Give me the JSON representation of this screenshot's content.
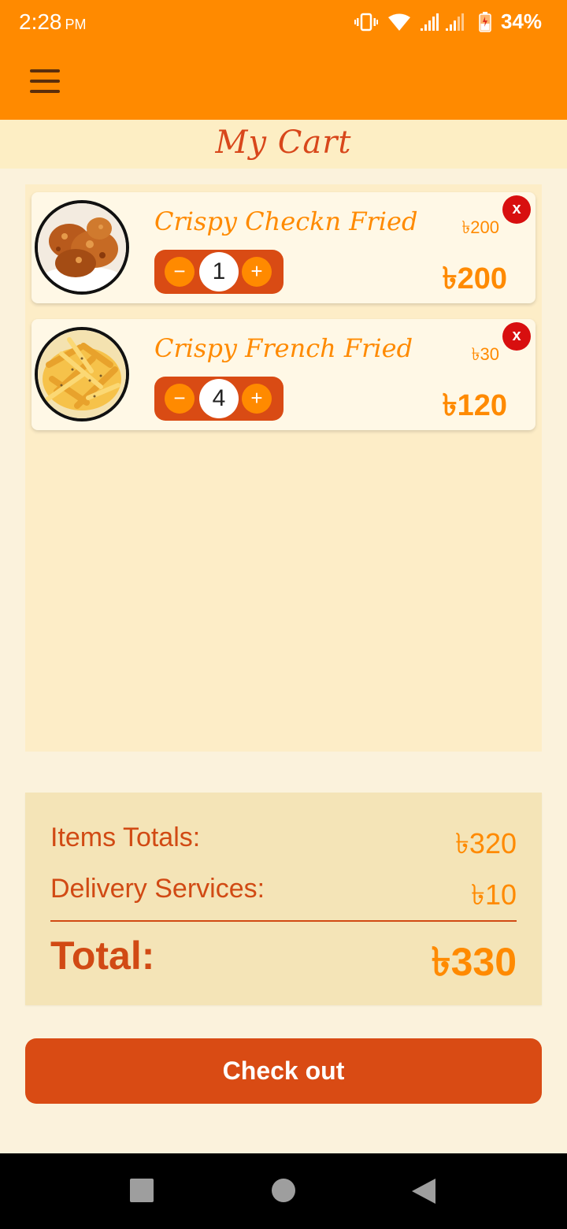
{
  "status_bar": {
    "time": "2:28",
    "ampm": "PM",
    "battery": "34%"
  },
  "page_title": "My Cart",
  "cart_items": [
    {
      "name": "Crispy Checkn Fried",
      "unit_price": "৳200",
      "quantity": "1",
      "line_total": "৳200",
      "remove_label": "x",
      "minus_label": "−",
      "plus_label": "+",
      "image": "fried-chicken-image"
    },
    {
      "name": "Crispy French Fried",
      "unit_price": "৳30",
      "quantity": "4",
      "line_total": "৳120",
      "remove_label": "x",
      "minus_label": "−",
      "plus_label": "+",
      "image": "french-fries-image"
    }
  ],
  "summary": {
    "items_label": "Items Totals:",
    "items_value": "৳320",
    "delivery_label": "Delivery Services:",
    "delivery_value": "৳10",
    "total_label": "Total:",
    "total_value": "৳330"
  },
  "checkout_label": "Check out",
  "colors": {
    "primary": "#ff8a00",
    "accent": "#d94b14",
    "remove": "#d80f0f",
    "background": "#fbf2dc"
  }
}
